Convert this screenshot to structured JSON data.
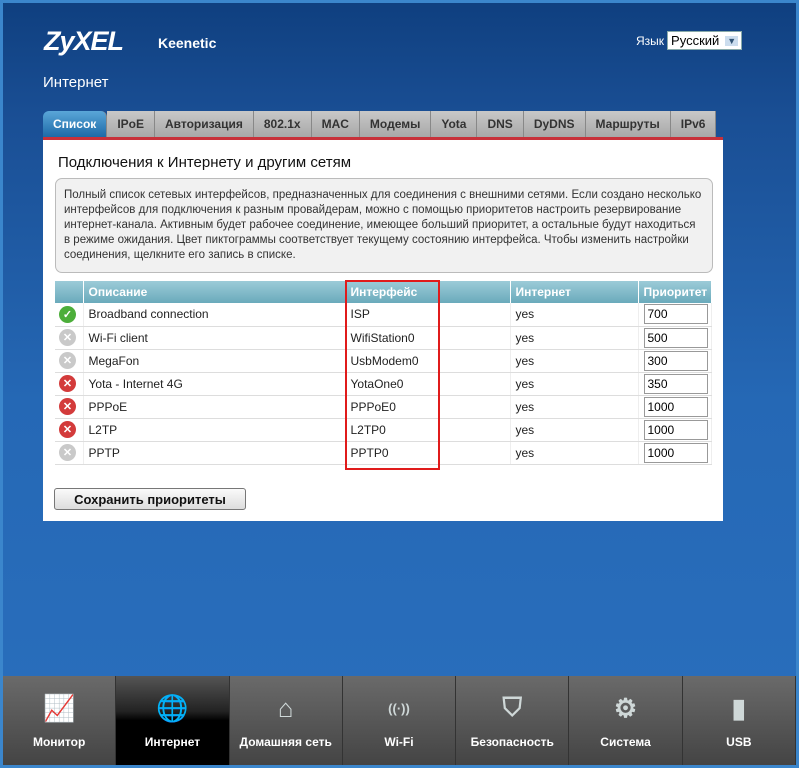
{
  "header": {
    "logo": "ZyXEL",
    "product": "Keenetic",
    "lang_label": "Язык",
    "lang_value": "Русский",
    "page_title": "Интернет"
  },
  "tabs": [
    "Список",
    "IPoE",
    "Авторизация",
    "802.1x",
    "MAC",
    "Модемы",
    "Yota",
    "DNS",
    "DyDNS",
    "Маршруты",
    "IPv6"
  ],
  "main": {
    "title": "Подключения к Интернету и другим сетям",
    "info": "Полный список сетевых интерфейсов, предназначенных для соединения с внешними сетями. Если создано несколько интерфейсов для подключения к разным провайдерам, можно с помощью приоритетов настроить резервирование интернет-канала. Активным будет рабочее соединение, имеющее больший приоритет, а остальные будут находиться в режиме ожидания. Цвет пиктограммы соответствует текущему состоянию интерфейса. Чтобы изменить настройки соединения, щелкните его запись в списке.",
    "columns": [
      "Описание",
      "Интерфейс",
      "Интернет",
      "Приоритет"
    ],
    "rows": [
      {
        "status": "ok",
        "desc": "Broadband connection",
        "iface": "ISP",
        "inet": "yes",
        "prio": "700"
      },
      {
        "status": "off",
        "desc": "Wi-Fi client",
        "iface": "WifiStation0",
        "inet": "yes",
        "prio": "500"
      },
      {
        "status": "off",
        "desc": "MegaFon",
        "iface": "UsbModem0",
        "inet": "yes",
        "prio": "300"
      },
      {
        "status": "err",
        "desc": "Yota - Internet 4G",
        "iface": "YotaOne0",
        "inet": "yes",
        "prio": "350"
      },
      {
        "status": "err",
        "desc": "PPPoE",
        "iface": "PPPoE0",
        "inet": "yes",
        "prio": "1000"
      },
      {
        "status": "err",
        "desc": "L2TP",
        "iface": "L2TP0",
        "inet": "yes",
        "prio": "1000"
      },
      {
        "status": "off",
        "desc": "PPTP",
        "iface": "PPTP0",
        "inet": "yes",
        "prio": "1000"
      }
    ],
    "save_label": "Сохранить приоритеты"
  },
  "bottom_nav": [
    {
      "label": "Монитор",
      "icon": "monitor-icon"
    },
    {
      "label": "Интернет",
      "icon": "globe-icon",
      "active": true
    },
    {
      "label": "Домашняя сеть",
      "icon": "home-icon"
    },
    {
      "label": "Wi-Fi",
      "icon": "antenna-icon"
    },
    {
      "label": "Безопасность",
      "icon": "shield-icon"
    },
    {
      "label": "Система",
      "icon": "gear-icon"
    },
    {
      "label": "USB",
      "icon": "usb-icon"
    }
  ]
}
